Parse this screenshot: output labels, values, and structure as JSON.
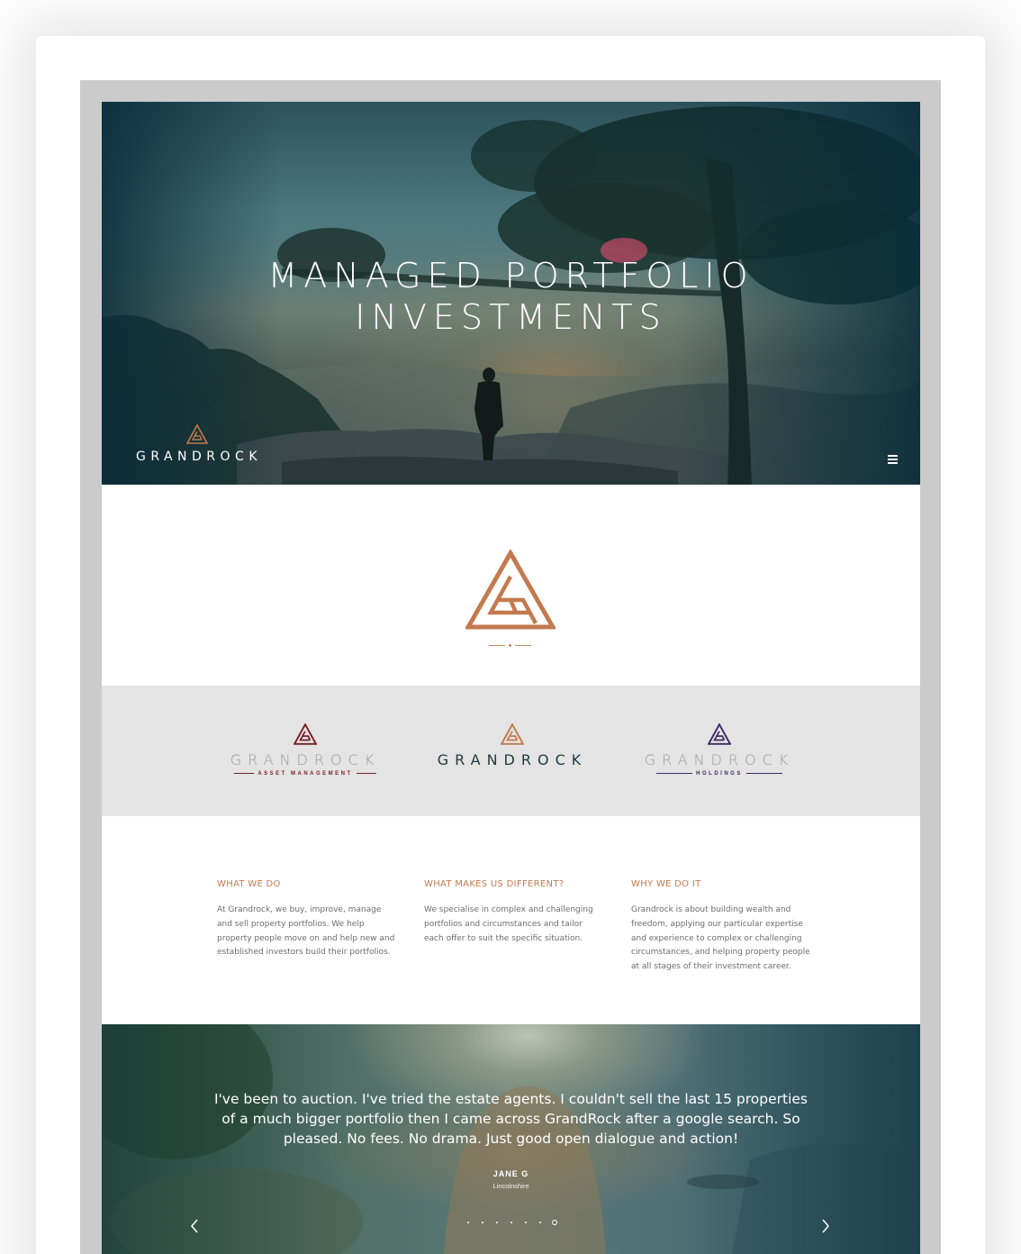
{
  "hero": {
    "title_line1": "MANAGED PORTFOLIO",
    "title_line2": "INVESTMENTS",
    "brand_word": "GRANDROCK",
    "menu_icon": "hamburger-menu-icon"
  },
  "brands": [
    {
      "word": "GRANDROCK",
      "sub": "ASSET MANAGEMENT",
      "color": "#7a1f24",
      "word_color": "#9a9a9a"
    },
    {
      "word": "GRANDROCK",
      "sub": "",
      "color": "#c47a4f",
      "word_color": "#1e3a44"
    },
    {
      "word": "GRANDROCK",
      "sub": "HOLDINGS",
      "color": "#3e2a62",
      "word_color": "#9a9a9a"
    }
  ],
  "info": {
    "what_we_do": {
      "title": "WHAT WE DO",
      "text": "At Grandrock, we buy, improve, manage and sell property portfolios. We help property people move on and help new and established investors build their portfolios."
    },
    "different": {
      "title": "WHAT MAKES US DIFFERENT?",
      "text": "We specialise in complex and challenging portfolios and circumstances and tailor each offer to suit the specific situation."
    },
    "why": {
      "title": "WHY WE DO IT",
      "text": "Grandrock is about building wealth and freedom, applying our particular expertise and experience to complex or challenging circumstances, and helping property people at all stages of their investment career."
    }
  },
  "testimonial": {
    "quote": "I've been to auction. I've tried the estate agents. I couldn't sell the last 15 properties of a much bigger portfolio then I came across GrandRock after a google search. So pleased. No fees. No drama. Just good open dialogue and action!",
    "author": "JANE G",
    "location": "Lincolnshire",
    "slide_count": 7,
    "active_slide": 7
  },
  "colors": {
    "accent": "#c47a4f",
    "teal_dark": "#0b3442",
    "strip_gray": "#e4e4e4"
  }
}
